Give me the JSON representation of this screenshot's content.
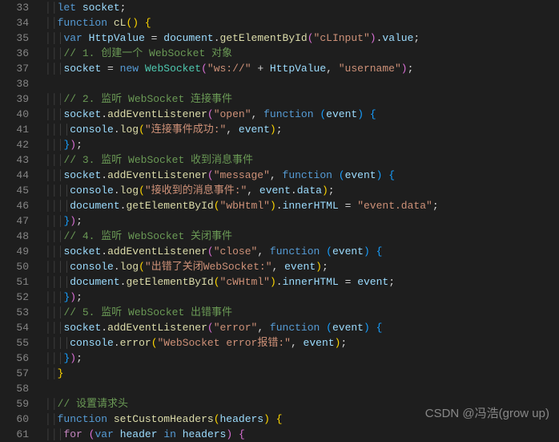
{
  "startLine": 33,
  "endLine": 61,
  "watermark": "CSDN @冯浩(grow up)",
  "lines": {
    "33": [
      [
        "sp",
        "    "
      ],
      [
        "kw",
        "let"
      ],
      [
        "pn",
        " "
      ],
      [
        "var",
        "socket"
      ],
      [
        "pn",
        ";"
      ]
    ],
    "34": [
      [
        "sp",
        "    "
      ],
      [
        "kw",
        "function"
      ],
      [
        "pn",
        " "
      ],
      [
        "fn",
        "cL"
      ],
      [
        "brace1",
        "()"
      ],
      [
        "pn",
        " "
      ],
      [
        "brace1",
        "{"
      ]
    ],
    "35": [
      [
        "sp",
        "      "
      ],
      [
        "kw",
        "var"
      ],
      [
        "pn",
        " "
      ],
      [
        "var",
        "HttpValue"
      ],
      [
        "pn",
        " = "
      ],
      [
        "var",
        "document"
      ],
      [
        "pn",
        "."
      ],
      [
        "fn",
        "getElementById"
      ],
      [
        "brace2",
        "("
      ],
      [
        "str",
        "\"cLInput\""
      ],
      [
        "brace2",
        ")"
      ],
      [
        "pn",
        "."
      ],
      [
        "var",
        "value"
      ],
      [
        "pn",
        ";"
      ]
    ],
    "36": [
      [
        "sp",
        "      "
      ],
      [
        "cm",
        "// 1. 创建一个 WebSocket 对象"
      ]
    ],
    "37": [
      [
        "sp",
        "      "
      ],
      [
        "var",
        "socket"
      ],
      [
        "pn",
        " = "
      ],
      [
        "kw",
        "new"
      ],
      [
        "pn",
        " "
      ],
      [
        "cls",
        "WebSocket"
      ],
      [
        "brace2",
        "("
      ],
      [
        "str",
        "\"ws://\""
      ],
      [
        "pn",
        " + "
      ],
      [
        "var",
        "HttpValue"
      ],
      [
        "pn",
        ", "
      ],
      [
        "str",
        "\"username\""
      ],
      [
        "brace2",
        ")"
      ],
      [
        "pn",
        ";"
      ]
    ],
    "38": [
      [
        "sp",
        ""
      ]
    ],
    "39": [
      [
        "sp",
        "      "
      ],
      [
        "cm",
        "// 2. 监听 WebSocket 连接事件"
      ]
    ],
    "40": [
      [
        "sp",
        "      "
      ],
      [
        "var",
        "socket"
      ],
      [
        "pn",
        "."
      ],
      [
        "fn",
        "addEventListener"
      ],
      [
        "brace2",
        "("
      ],
      [
        "str",
        "\"open\""
      ],
      [
        "pn",
        ", "
      ],
      [
        "kw",
        "function"
      ],
      [
        "pn",
        " "
      ],
      [
        "brace3",
        "("
      ],
      [
        "var",
        "event"
      ],
      [
        "brace3",
        ")"
      ],
      [
        "pn",
        " "
      ],
      [
        "brace3",
        "{"
      ]
    ],
    "41": [
      [
        "sp",
        "        "
      ],
      [
        "var",
        "console"
      ],
      [
        "pn",
        "."
      ],
      [
        "fn",
        "log"
      ],
      [
        "brace1",
        "("
      ],
      [
        "str",
        "\"连接事件成功:\""
      ],
      [
        "pn",
        ", "
      ],
      [
        "var",
        "event"
      ],
      [
        "brace1",
        ")"
      ],
      [
        "pn",
        ";"
      ]
    ],
    "42": [
      [
        "sp",
        "      "
      ],
      [
        "brace3",
        "}"
      ],
      [
        "brace2",
        ")"
      ],
      [
        "pn",
        ";"
      ]
    ],
    "43": [
      [
        "sp",
        "      "
      ],
      [
        "cm",
        "// 3. 监听 WebSocket 收到消息事件"
      ]
    ],
    "44": [
      [
        "sp",
        "      "
      ],
      [
        "var",
        "socket"
      ],
      [
        "pn",
        "."
      ],
      [
        "fn",
        "addEventListener"
      ],
      [
        "brace2",
        "("
      ],
      [
        "str",
        "\"message\""
      ],
      [
        "pn",
        ", "
      ],
      [
        "kw",
        "function"
      ],
      [
        "pn",
        " "
      ],
      [
        "brace3",
        "("
      ],
      [
        "var",
        "event"
      ],
      [
        "brace3",
        ")"
      ],
      [
        "pn",
        " "
      ],
      [
        "brace3",
        "{"
      ]
    ],
    "45": [
      [
        "sp",
        "        "
      ],
      [
        "var",
        "console"
      ],
      [
        "pn",
        "."
      ],
      [
        "fn",
        "log"
      ],
      [
        "brace1",
        "("
      ],
      [
        "str",
        "\"接收到的消息事件:\""
      ],
      [
        "pn",
        ", "
      ],
      [
        "var",
        "event"
      ],
      [
        "pn",
        "."
      ],
      [
        "var",
        "data"
      ],
      [
        "brace1",
        ")"
      ],
      [
        "pn",
        ";"
      ]
    ],
    "46": [
      [
        "sp",
        "        "
      ],
      [
        "var",
        "document"
      ],
      [
        "pn",
        "."
      ],
      [
        "fn",
        "getElementById"
      ],
      [
        "brace1",
        "("
      ],
      [
        "str",
        "\"wbHtml\""
      ],
      [
        "brace1",
        ")"
      ],
      [
        "pn",
        "."
      ],
      [
        "var",
        "innerHTML"
      ],
      [
        "pn",
        " = "
      ],
      [
        "str",
        "\"event.data\""
      ],
      [
        "pn",
        ";"
      ]
    ],
    "47": [
      [
        "sp",
        "      "
      ],
      [
        "brace3",
        "}"
      ],
      [
        "brace2",
        ")"
      ],
      [
        "pn",
        ";"
      ]
    ],
    "48": [
      [
        "sp",
        "      "
      ],
      [
        "cm",
        "// 4. 监听 WebSocket 关闭事件"
      ]
    ],
    "49": [
      [
        "sp",
        "      "
      ],
      [
        "var",
        "socket"
      ],
      [
        "pn",
        "."
      ],
      [
        "fn",
        "addEventListener"
      ],
      [
        "brace2",
        "("
      ],
      [
        "str",
        "\"close\""
      ],
      [
        "pn",
        ", "
      ],
      [
        "kw",
        "function"
      ],
      [
        "pn",
        " "
      ],
      [
        "brace3",
        "("
      ],
      [
        "var",
        "event"
      ],
      [
        "brace3",
        ")"
      ],
      [
        "pn",
        " "
      ],
      [
        "brace3",
        "{"
      ]
    ],
    "50": [
      [
        "sp",
        "        "
      ],
      [
        "var",
        "console"
      ],
      [
        "pn",
        "."
      ],
      [
        "fn",
        "log"
      ],
      [
        "brace1",
        "("
      ],
      [
        "str",
        "\"出错了关闭WebSocket:\""
      ],
      [
        "pn",
        ", "
      ],
      [
        "var",
        "event"
      ],
      [
        "brace1",
        ")"
      ],
      [
        "pn",
        ";"
      ]
    ],
    "51": [
      [
        "sp",
        "        "
      ],
      [
        "var",
        "document"
      ],
      [
        "pn",
        "."
      ],
      [
        "fn",
        "getElementById"
      ],
      [
        "brace1",
        "("
      ],
      [
        "str",
        "\"cWHtml\""
      ],
      [
        "brace1",
        ")"
      ],
      [
        "pn",
        "."
      ],
      [
        "var",
        "innerHTML"
      ],
      [
        "pn",
        " = "
      ],
      [
        "var",
        "event"
      ],
      [
        "pn",
        ";"
      ]
    ],
    "52": [
      [
        "sp",
        "      "
      ],
      [
        "brace3",
        "}"
      ],
      [
        "brace2",
        ")"
      ],
      [
        "pn",
        ";"
      ]
    ],
    "53": [
      [
        "sp",
        "      "
      ],
      [
        "cm",
        "// 5. 监听 WebSocket 出错事件"
      ]
    ],
    "54": [
      [
        "sp",
        "      "
      ],
      [
        "var",
        "socket"
      ],
      [
        "pn",
        "."
      ],
      [
        "fn",
        "addEventListener"
      ],
      [
        "brace2",
        "("
      ],
      [
        "str",
        "\"error\""
      ],
      [
        "pn",
        ", "
      ],
      [
        "kw",
        "function"
      ],
      [
        "pn",
        " "
      ],
      [
        "brace3",
        "("
      ],
      [
        "var",
        "event"
      ],
      [
        "brace3",
        ")"
      ],
      [
        "pn",
        " "
      ],
      [
        "brace3",
        "{"
      ]
    ],
    "55": [
      [
        "sp",
        "        "
      ],
      [
        "var",
        "console"
      ],
      [
        "pn",
        "."
      ],
      [
        "fn",
        "error"
      ],
      [
        "brace1",
        "("
      ],
      [
        "str",
        "\"WebSocket error报错:\""
      ],
      [
        "pn",
        ", "
      ],
      [
        "var",
        "event"
      ],
      [
        "brace1",
        ")"
      ],
      [
        "pn",
        ";"
      ]
    ],
    "56": [
      [
        "sp",
        "      "
      ],
      [
        "brace3",
        "}"
      ],
      [
        "brace2",
        ")"
      ],
      [
        "pn",
        ";"
      ]
    ],
    "57": [
      [
        "sp",
        "    "
      ],
      [
        "brace1",
        "}"
      ]
    ],
    "58": [
      [
        "sp",
        ""
      ]
    ],
    "59": [
      [
        "sp",
        "    "
      ],
      [
        "cm",
        "// 设置请求头"
      ]
    ],
    "60": [
      [
        "sp",
        "    "
      ],
      [
        "kw",
        "function"
      ],
      [
        "pn",
        " "
      ],
      [
        "fn",
        "setCustomHeaders"
      ],
      [
        "brace1",
        "("
      ],
      [
        "var",
        "headers"
      ],
      [
        "brace1",
        ")"
      ],
      [
        "pn",
        " "
      ],
      [
        "brace1",
        "{"
      ]
    ],
    "61": [
      [
        "sp",
        "      "
      ],
      [
        "kw2",
        "for"
      ],
      [
        "pn",
        " "
      ],
      [
        "brace2",
        "("
      ],
      [
        "kw",
        "var"
      ],
      [
        "pn",
        " "
      ],
      [
        "var",
        "header"
      ],
      [
        "pn",
        " "
      ],
      [
        "kw",
        "in"
      ],
      [
        "pn",
        " "
      ],
      [
        "var",
        "headers"
      ],
      [
        "brace2",
        ")"
      ],
      [
        "pn",
        " "
      ],
      [
        "brace2",
        "{"
      ]
    ]
  }
}
